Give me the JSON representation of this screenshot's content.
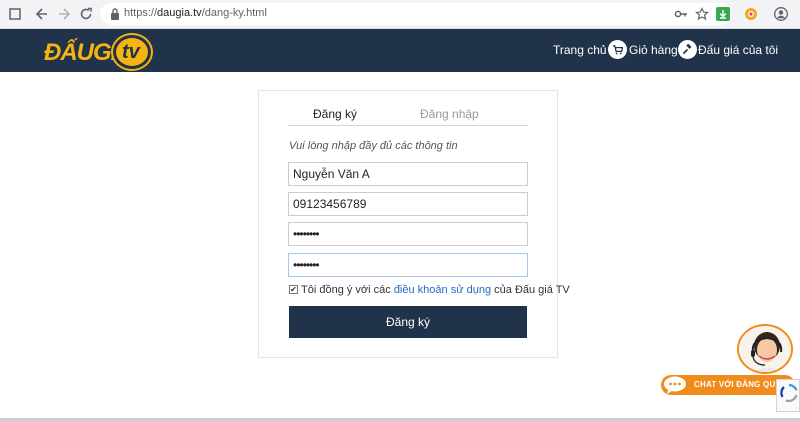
{
  "browser": {
    "url_scheme": "https://",
    "url_host": "daugia.tv",
    "url_path": "/dang-ky.html"
  },
  "site": {
    "logo_text": "ĐẤUGIÁ.",
    "logo_badge": "tv",
    "nav": {
      "home": "Trang chủ",
      "cart": "Giỏ hàng",
      "my_auctions": "Đấu giá của tôi"
    }
  },
  "form": {
    "tab_register": "Đăng ký",
    "tab_login": "Đăng nhập",
    "hint": "Vui lòng nhập đầy đủ các thông tin",
    "name_value": "Nguyễn Văn A",
    "phone_value": "09123456789",
    "password_value": "••••••••",
    "confirm_value": "••••••••",
    "agree_prefix": "Tôi đồng ý với các ",
    "agree_link": "điều khoản sử dụng",
    "agree_suffix": " của Đấu giá TV",
    "agree_checked": true,
    "submit_label": "Đăng ký"
  },
  "chat": {
    "label": "CHAT VỚI ĐĂNG QUANG"
  },
  "colors": {
    "header_bg": "#20334a",
    "logo_yellow": "#f5b40f",
    "chat_orange": "#f08c1b",
    "link_blue": "#1f6bc1"
  }
}
